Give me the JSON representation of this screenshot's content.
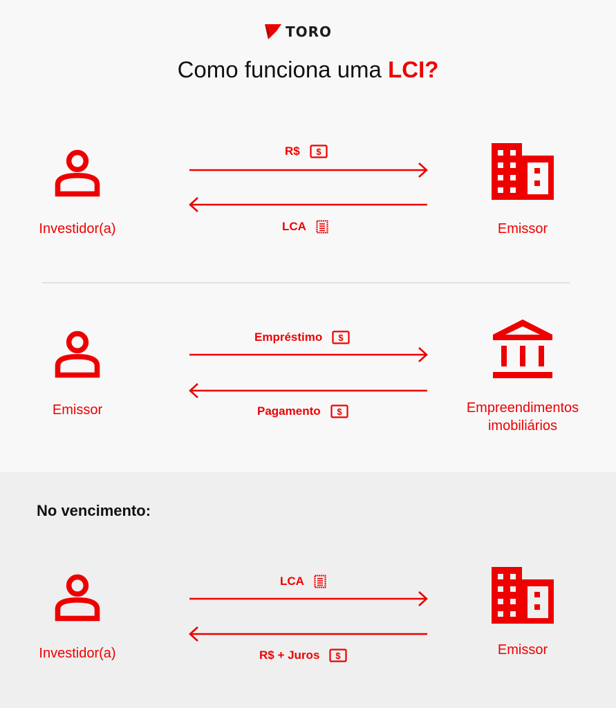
{
  "brand": {
    "name": "TORO",
    "accent_color": "#ee0000"
  },
  "title": {
    "prefix": "Como funciona uma ",
    "highlight": "LCI?"
  },
  "sections": [
    {
      "left_node": {
        "label": "Investidor(a)",
        "icon": "person-icon"
      },
      "right_node": {
        "label": "Emissor",
        "icon": "building-icon"
      },
      "forward_flow": {
        "label": "R$",
        "icon": "money-icon"
      },
      "backward_flow": {
        "label": "LCA",
        "icon": "receipt-icon"
      }
    },
    {
      "left_node": {
        "label": "Emissor",
        "icon": "person-icon"
      },
      "right_node": {
        "label_line1": "Empreendimentos",
        "label_line2": "imobiliários",
        "icon": "bank-icon"
      },
      "forward_flow": {
        "label": "Empréstimo",
        "icon": "money-icon"
      },
      "backward_flow": {
        "label": "Pagamento",
        "icon": "money-icon"
      }
    }
  ],
  "maturity": {
    "heading": "No vencimento:",
    "left_node": {
      "label": "Investidor(a)",
      "icon": "person-icon"
    },
    "right_node": {
      "label": "Emissor",
      "icon": "building-icon"
    },
    "forward_flow": {
      "label": "LCA",
      "icon": "receipt-icon"
    },
    "backward_flow": {
      "label": "R$ + Juros",
      "icon": "money-icon"
    }
  }
}
